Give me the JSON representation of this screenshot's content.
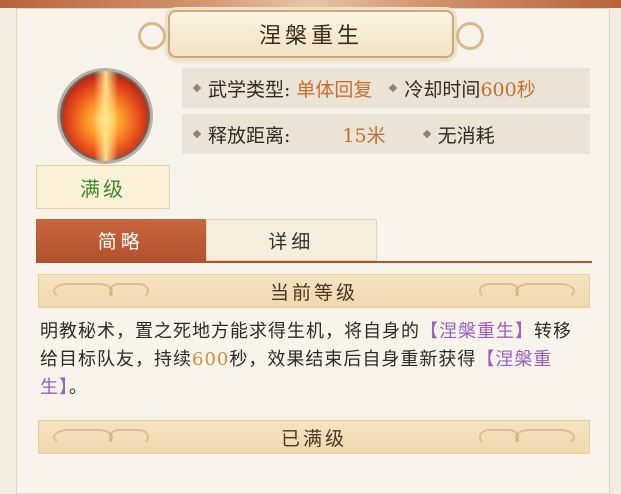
{
  "skill": {
    "name": "涅槃重生",
    "level_status": "满级"
  },
  "info": {
    "type_label": "武学类型:",
    "type_value": "单体回复",
    "cooldown_label": "冷却时间",
    "cooldown_value": "600秒",
    "range_label": "释放距离:",
    "range_value": "15米",
    "cost_label": "无消耗"
  },
  "tabs": [
    {
      "label": "简略",
      "active": true
    },
    {
      "label": "详细",
      "active": false
    }
  ],
  "current_level_header": "当前等级",
  "description": {
    "part1": "明教秘术，置之死地方能求得生机，将自身的",
    "skill_ref1": "【涅槃重生】",
    "part2": "转移给目标队友，持续",
    "duration": "600",
    "part3": "秒，效果结束后自身重新获得",
    "skill_ref2": "【涅槃重生】",
    "part4": "。"
  },
  "max_level_text": "已满级",
  "colors": {
    "accent_tab": "#b4512e",
    "level_green": "#3e8a2a",
    "skill_purple": "#9a5fc0",
    "value_orange": "#c2732f"
  }
}
